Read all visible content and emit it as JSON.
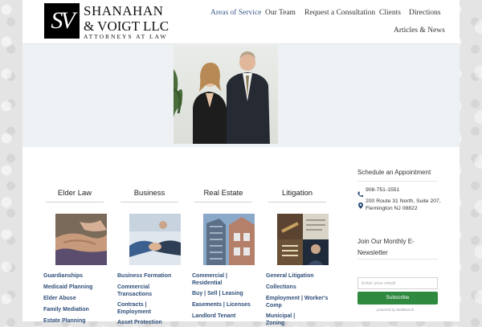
{
  "logo": {
    "mark": "SV",
    "line1": "SHANAHAN",
    "line2": "& VOIGT LLC",
    "line3": "ATTORNEYS AT LAW"
  },
  "nav": {
    "items": [
      {
        "label": "Areas of Service",
        "active": true
      },
      {
        "label": "Our Team"
      },
      {
        "label": "Request a Consultation"
      },
      {
        "label": "Clients"
      },
      {
        "label": "Directions"
      },
      {
        "label": "Articles & News"
      }
    ]
  },
  "columns": [
    {
      "title": "Elder Law",
      "links": [
        "Guardianships",
        "Medicaid Planning",
        "Elder Abuse",
        "Family Mediation",
        "Estate Planning"
      ]
    },
    {
      "title": "Business",
      "links": [
        "Business Formation",
        "Commercial Transactions",
        "Contracts | Employment",
        "Asset Protection"
      ]
    },
    {
      "title": "Real Estate",
      "links": [
        "Commercial | Residential",
        "Buy | Sell | Leasing",
        "Easements | Licenses",
        "Landlord Tenant"
      ]
    },
    {
      "title": "Litigation",
      "links": [
        "General Litigation",
        "Collections",
        "Employment | Worker's Comp",
        "Municipal | Zoning"
      ]
    }
  ],
  "sidebar": {
    "appointment_heading": "Schedule an Appointment",
    "phone": "908-751-1551",
    "address": "200 Route 31 North, Suite 207, Flemington NJ 08822",
    "newsletter_heading": "Join Our Monthly E-Newsletter",
    "email_placeholder": "Enter your email",
    "subscribe_label": "Subscribe",
    "powered_by": "powered by MailMunch"
  },
  "colors": {
    "nav_active": "#3a5a8c",
    "link": "#2f4f7a",
    "subscribe": "#2f8a3f"
  },
  "icons": {
    "phone": "phone-icon",
    "location": "map-marker-icon"
  }
}
